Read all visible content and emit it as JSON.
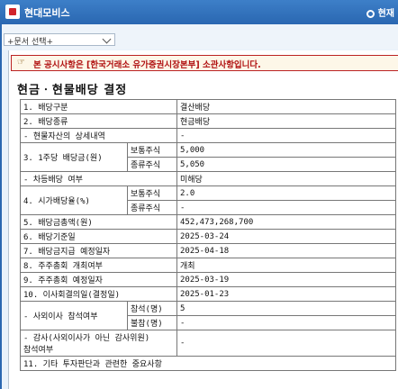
{
  "window": {
    "title": "현대모비스",
    "status": "현재"
  },
  "toolbar": {
    "doc_select": "+문서 선택+"
  },
  "notice": {
    "icon": "pointing-hand-icon",
    "text": "본 공시사항은 [한국거래소 유가증권시장본부] 소관사항입니다."
  },
  "heading": "현금ㆍ현물배당 결정",
  "rows": {
    "r1": {
      "label": "1. 배당구분",
      "value": "결산배당"
    },
    "r2": {
      "label": "2. 배당종류",
      "value": "현금배당"
    },
    "r2a": {
      "label": "- 현물자산의 상세내역",
      "value": "-"
    },
    "r3": {
      "label": "3. 1주당 배당금(원)",
      "sub1": "보통주식",
      "v1": "5,000",
      "sub2": "종류주식",
      "v2": "5,050"
    },
    "r3a": {
      "label": "- 차등배당 여부",
      "value": "미해당"
    },
    "r4": {
      "label": "4. 시가배당율(%)",
      "sub1": "보통주식",
      "v1": "2.0",
      "sub2": "종류주식",
      "v2": "-"
    },
    "r5": {
      "label": "5. 배당금총액(원)",
      "value": "452,473,268,700"
    },
    "r6": {
      "label": "6. 배당기준일",
      "value": "2025-03-24"
    },
    "r7": {
      "label": "7. 배당금지급 예정일자",
      "value": "2025-04-18"
    },
    "r8": {
      "label": "8. 주주총회 개최여부",
      "value": "개최"
    },
    "r9": {
      "label": "9. 주주총회 예정일자",
      "value": "2025-03-19"
    },
    "r10": {
      "label": "10. 이사회결의일(결정일)",
      "value": "2025-01-23"
    },
    "r10a": {
      "label": "- 사외이사 참석여부",
      "sub1": "참석(명)",
      "v1": "5",
      "sub2": "불참(명)",
      "v2": "-"
    },
    "r10b": {
      "label": "- 감사(사외이사가 아닌 감사위원)",
      "label2": "참석여부",
      "value": "-"
    },
    "r11": {
      "label": "11. 기타 투자판단과 관련한 중요사항"
    }
  }
}
